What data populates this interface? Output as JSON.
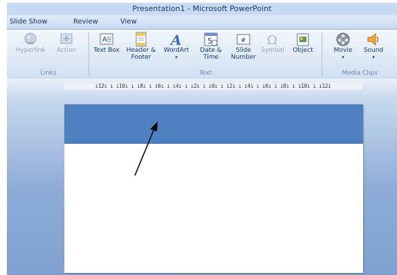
{
  "window": {
    "title": "Presentation1 - Microsoft PowerPoint"
  },
  "tabs": [
    {
      "label": "Slide Show"
    },
    {
      "label": "Review"
    },
    {
      "label": "View"
    }
  ],
  "ribbon": {
    "groups": {
      "links": {
        "label": "Links",
        "buttons": [
          {
            "label": "Hyperlink",
            "icon": "hyperlink-icon",
            "enabled": false
          },
          {
            "label": "Action",
            "icon": "action-icon",
            "enabled": false
          }
        ]
      },
      "text": {
        "label": "Text",
        "buttons": [
          {
            "label": "Text Box",
            "icon": "text-box-icon",
            "enabled": true
          },
          {
            "label": "Header & Footer",
            "icon": "header-footer-icon",
            "enabled": true
          },
          {
            "label": "WordArt",
            "icon": "wordart-icon",
            "enabled": true,
            "dropdown": true
          },
          {
            "label": "Date & Time",
            "icon": "date-time-icon",
            "enabled": true
          },
          {
            "label": "Slide Number",
            "icon": "slide-number-icon",
            "enabled": true
          },
          {
            "label": "Symbol",
            "icon": "symbol-icon",
            "enabled": false
          },
          {
            "label": "Object",
            "icon": "object-icon",
            "enabled": true
          }
        ]
      },
      "media": {
        "label": "Media Clips",
        "buttons": [
          {
            "label": "Movie",
            "icon": "movie-icon",
            "enabled": true,
            "dropdown": true
          },
          {
            "label": "Sound",
            "icon": "sound-icon",
            "enabled": true,
            "dropdown": true
          }
        ]
      }
    }
  },
  "ruler": {
    "text": "ı12ı ı ı10ı ı ı8ı ı ı6ı ı ı4ı ı ı2ı ı ı0ı ı ı2ı ı ı4ı ı ı6ı ı ı8ı ı ı10ı ı ı12ı"
  },
  "colors": {
    "slide_header": "#4e7fbf",
    "ribbon_label": "#123a74",
    "disabled_label": "#8ea5c4"
  }
}
